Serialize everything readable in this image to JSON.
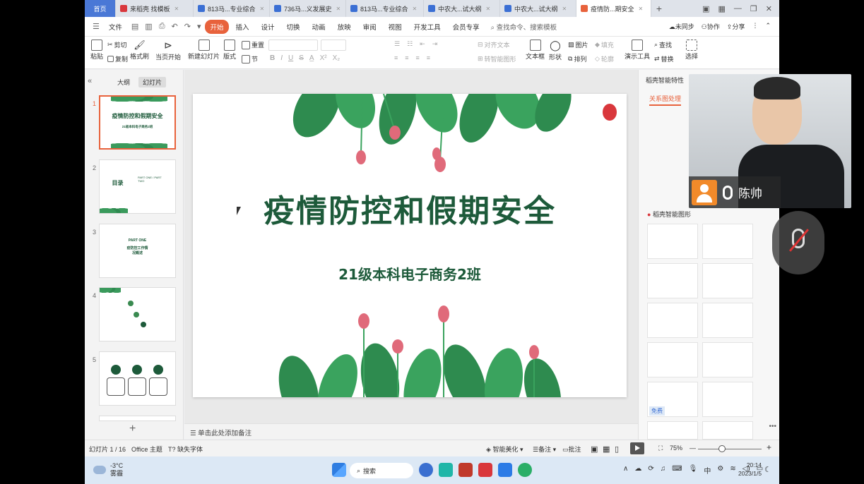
{
  "tabs": [
    {
      "label": "首页",
      "color": "#4a78d6"
    },
    {
      "label": "来稻壳 找模板",
      "color": "#d9373c"
    },
    {
      "label": "813马...专业综合",
      "color": "#3b6fd4"
    },
    {
      "label": "736马...义发展史",
      "color": "#3b6fd4"
    },
    {
      "label": "813马...专业综合",
      "color": "#3b6fd4"
    },
    {
      "label": "中农大...试大纲",
      "color": "#3b6fd4"
    },
    {
      "label": "中农大...试大纲",
      "color": "#3b6fd4"
    },
    {
      "label": "疫情防...期安全",
      "color": "#e8623c"
    }
  ],
  "menu": {
    "file": "文件",
    "items": [
      "开始",
      "插入",
      "设计",
      "切换",
      "动画",
      "放映",
      "审阅",
      "视图",
      "开发工具",
      "会员专享"
    ],
    "search": "查找命令、搜索模板",
    "right": [
      "未同步",
      "协作",
      "分享"
    ]
  },
  "ribbon": {
    "paste": "粘贴",
    "cut": "剪切",
    "copy": "复制",
    "format_painter": "格式刷",
    "from_current": "当页开始",
    "new_slide": "新建幻灯片",
    "layout": "版式",
    "section": "节",
    "reset": "重置",
    "align_text": "对齐文本",
    "smart_shape": "转智能图形",
    "textbox": "文本框",
    "shape": "形状",
    "picture": "图片",
    "arrange": "排列",
    "fill": "填充",
    "outline": "轮廓",
    "present_tools": "演示工具",
    "find": "查找",
    "replace": "替换",
    "select": "选择"
  },
  "left_panel": {
    "tab_outline": "大纲",
    "tab_slides": "幻灯片",
    "thumbs": [
      {
        "num": "1",
        "title": "疫情防控和假期安全",
        "sub": "21级本科电子商务2班"
      },
      {
        "num": "2",
        "title": "目录",
        "sub": "PART ONE / PART TWO"
      },
      {
        "num": "3",
        "title": "PART ONE",
        "sub": "疫防控工作情况概述"
      },
      {
        "num": "4",
        "title": "",
        "sub": ""
      },
      {
        "num": "5",
        "title": "",
        "sub": ""
      }
    ]
  },
  "slide": {
    "title": "疫情防控和假期安全",
    "subtitle": "21级本科电子商务2班",
    "notes": "单击此处添加备注"
  },
  "right_panel": {
    "header": "稻壳智能特性",
    "tab": "关系图处理",
    "section": "稻壳智能图形",
    "free_tag": "免费"
  },
  "status": {
    "slide_count": "幻灯片 1 / 16",
    "theme": "Office 主题",
    "missing_font": "缺失字体",
    "beautify": "智能美化",
    "notes": "备注",
    "comment": "批注",
    "zoom": "75%"
  },
  "taskbar": {
    "temp": "-3°C",
    "weather": "雾霾",
    "search": "搜索",
    "ime": "中",
    "time": "20:14",
    "date": "2023/1/5"
  },
  "video": {
    "name": "陈帅"
  }
}
